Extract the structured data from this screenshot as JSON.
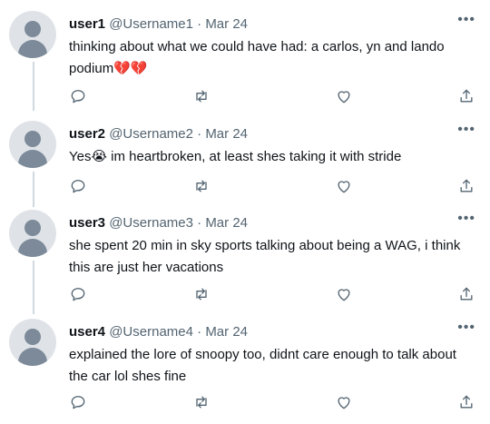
{
  "tweets": [
    {
      "display_name": "user1",
      "handle": "@Username1",
      "separator": "·",
      "date": "Mar 24",
      "text": "thinking about what we could have had: a carlos, yn and lando podium💔💔"
    },
    {
      "display_name": "user2",
      "handle": "@Username2",
      "separator": "·",
      "date": "Mar 24",
      "text": "Yes😭 im heartbroken, at least shes taking it with stride"
    },
    {
      "display_name": "user3",
      "handle": "@Username3",
      "separator": "·",
      "date": "Mar 24",
      "text": "she spent 20 min in sky sports talking about being a WAG, i think this are just her vacations"
    },
    {
      "display_name": "user4",
      "handle": "@Username4",
      "separator": "·",
      "date": "Mar 24",
      "text": "explained the lore of snoopy too, didnt care enough to talk about the car lol shes fine"
    }
  ],
  "more_label": "•••",
  "colors": {
    "text": "#0f1419",
    "secondary": "#536471",
    "thread_line": "#cfd9de",
    "avatar_bg": "#dfe3e8",
    "avatar_fg": "#7c8a99"
  }
}
